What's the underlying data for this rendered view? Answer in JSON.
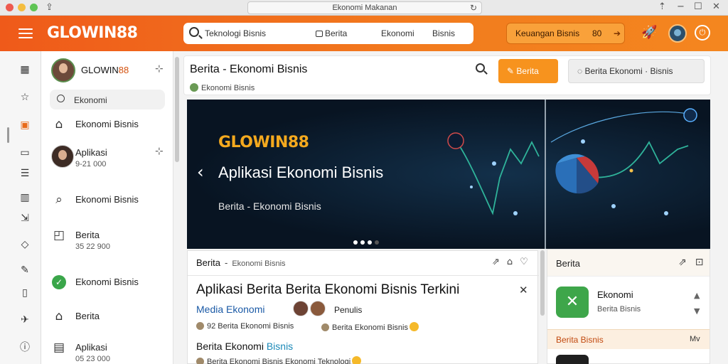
{
  "window": {
    "url": "Ekonomi Makanan"
  },
  "header": {
    "logo": "GLOWIN88",
    "search_query": "Teknologi Bisnis",
    "search_chip1": "Berita",
    "search_chip2": "Ekonomi",
    "search_chip3": "Bisnis",
    "promo_label": "Keuangan Bisnis",
    "promo_value": "80"
  },
  "sidebar": {
    "username_main": "GLOWIN",
    "username_accent": "88",
    "search_placeholder": "Ekonomi",
    "items": [
      {
        "label": "Ekonomi Bisnis"
      },
      {
        "label": "Aplikasi",
        "sub": "9-21 000"
      },
      {
        "label": "Ekonomi Bisnis"
      },
      {
        "label": "Berita",
        "sub": "35 22 900"
      },
      {
        "label": "Ekonomi Bisnis"
      },
      {
        "label": "Berita"
      },
      {
        "label": "Aplikasi",
        "sub": "05 23 000"
      }
    ]
  },
  "main": {
    "title": "Berita - Ekonomi Bisnis",
    "subtitle": "Ekonomi Bisnis",
    "primary_button": "Berita",
    "secondary_button": "Berita Ekonomi  ·  Bisnis"
  },
  "hero": {
    "brand": "GLOWIN88",
    "headline": "Aplikasi Ekonomi Bisnis",
    "subline": "Berita - Ekonomi Bisnis"
  },
  "article": {
    "tab": "Berita",
    "category": "Ekonomi Bisnis",
    "title": "Aplikasi Berita Berita Ekonomi Bisnis Terkini",
    "author": "Media Ekonomi",
    "role": "Penulis",
    "meta1": "92 Berita Ekonomi Bisnis",
    "meta2": "Berita Ekonomi Bisnis",
    "section_main": "Berita Ekonomi",
    "section_accent": "Bisnis",
    "meta3": "Berita Ekonomi Bisnis Ekonomi Teknologi"
  },
  "right_panel": {
    "title": "Berita",
    "app_name": "Ekonomi",
    "app_desc": "Berita Bisnis",
    "strip_title": "Berita Bisnis",
    "strip_right": "Mv"
  }
}
